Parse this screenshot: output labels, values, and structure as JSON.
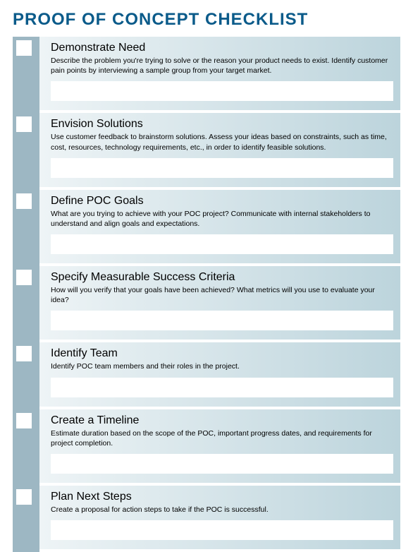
{
  "title": "PROOF OF CONCEPT CHECKLIST",
  "items": [
    {
      "title": "Demonstrate Need",
      "desc": "Describe the problem you're trying to solve or the reason your product needs to exist. Identify customer pain points by interviewing a sample group from your target market."
    },
    {
      "title": "Envision Solutions",
      "desc": "Use customer feedback to brainstorm solutions. Assess your ideas based on constraints, such as time, cost, resources, technology requirements, etc., in order to identify feasible solutions."
    },
    {
      "title": "Define POC Goals",
      "desc": "What are you trying to achieve with your POC project? Communicate with internal stakeholders to understand and align goals and expectations."
    },
    {
      "title": "Specify Measurable Success Criteria",
      "desc": "How will you verify that your goals have been achieved? What metrics will you use to evaluate your idea?"
    },
    {
      "title": "Identify Team",
      "desc": "Identify POC team members and their roles in the project."
    },
    {
      "title": "Create a Timeline",
      "desc": "Estimate duration based on the scope of the POC, important progress dates, and requirements for project completion."
    },
    {
      "title": "Plan Next Steps",
      "desc": "Create a proposal for action steps to take if the POC is successful."
    }
  ]
}
